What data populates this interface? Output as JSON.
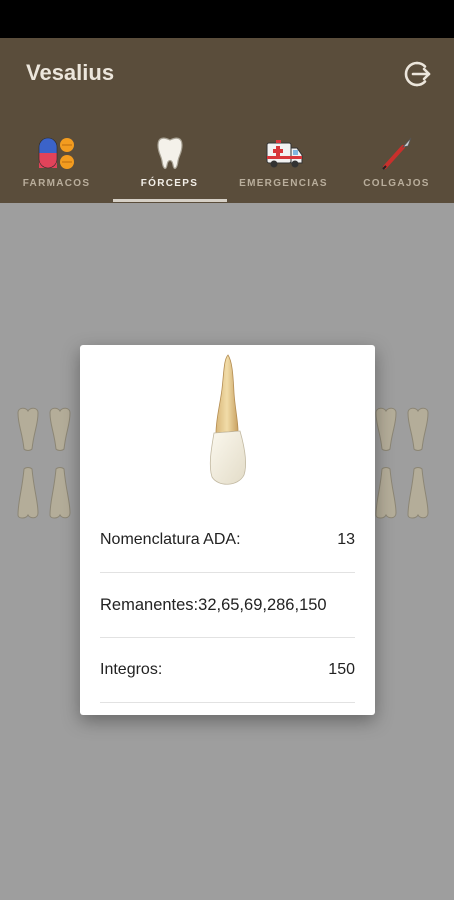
{
  "app": {
    "title": "Vesalius"
  },
  "header": {
    "logout_icon": "logout-icon"
  },
  "tabs": [
    {
      "label": "FARMACOS",
      "icon": "pills-icon",
      "active": false
    },
    {
      "label": "FÓRCEPS",
      "icon": "tooth-icon",
      "active": true
    },
    {
      "label": "EMERGENCIAS",
      "icon": "ambulance-icon",
      "active": false
    },
    {
      "label": "COLGAJOS",
      "icon": "scalpel-icon",
      "active": false
    }
  ],
  "dialog": {
    "image": "tooth-image",
    "rows": [
      {
        "key": "Nomenclatura ADA:",
        "value": "13"
      },
      {
        "combined": "Remanentes:32,65,69,286,150"
      },
      {
        "key": "Integros:",
        "value": "150"
      }
    ]
  },
  "colors": {
    "app_bar": "#5a4d3b",
    "status_bar": "#000000",
    "background": "#9e9e9e",
    "dialog": "#ffffff"
  }
}
